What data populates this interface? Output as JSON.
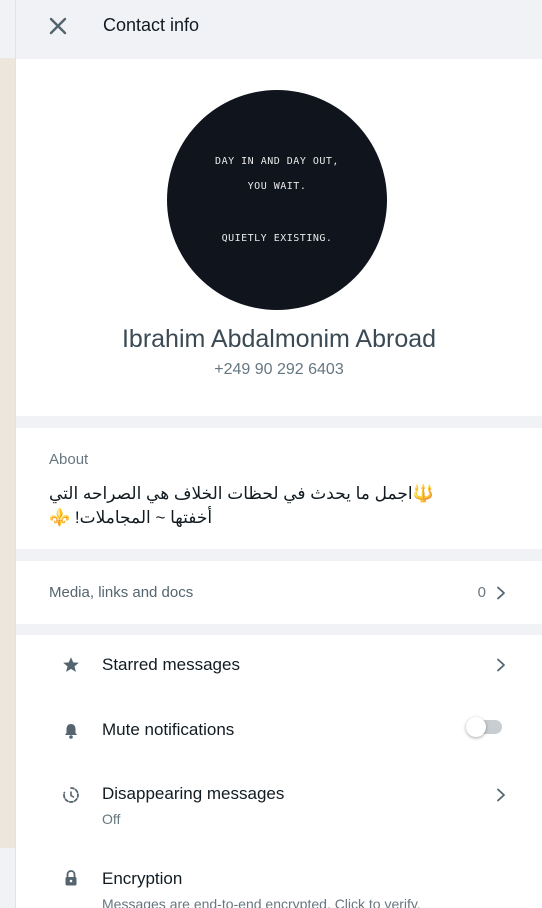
{
  "header": {
    "title": "Contact info"
  },
  "profile": {
    "avatar_lines": [
      "DAY IN AND DAY OUT,",
      "YOU WAIT.",
      "QUIETLY EXISTING."
    ],
    "name": "Ibrahim Abdalmonim Abroad",
    "phone": "+249 90 292 6403"
  },
  "about": {
    "label": "About",
    "text": "🔱اجمل ما يحدث في لحظات الخلاف هي الصراحه التي أخفتها ~ المجاملات! ⚜️"
  },
  "media": {
    "label": "Media, links and docs",
    "count": "0"
  },
  "settings": {
    "starred": {
      "label": "Starred messages",
      "icon": "star-icon"
    },
    "mute": {
      "label": "Mute notifications",
      "icon": "bell-icon",
      "enabled": false
    },
    "disappearing": {
      "label": "Disappearing messages",
      "value": "Off",
      "icon": "timer-icon"
    },
    "encryption": {
      "label": "Encryption",
      "subtitle": "Messages are end-to-end encrypted. Click to verify.",
      "icon": "lock-icon"
    }
  }
}
